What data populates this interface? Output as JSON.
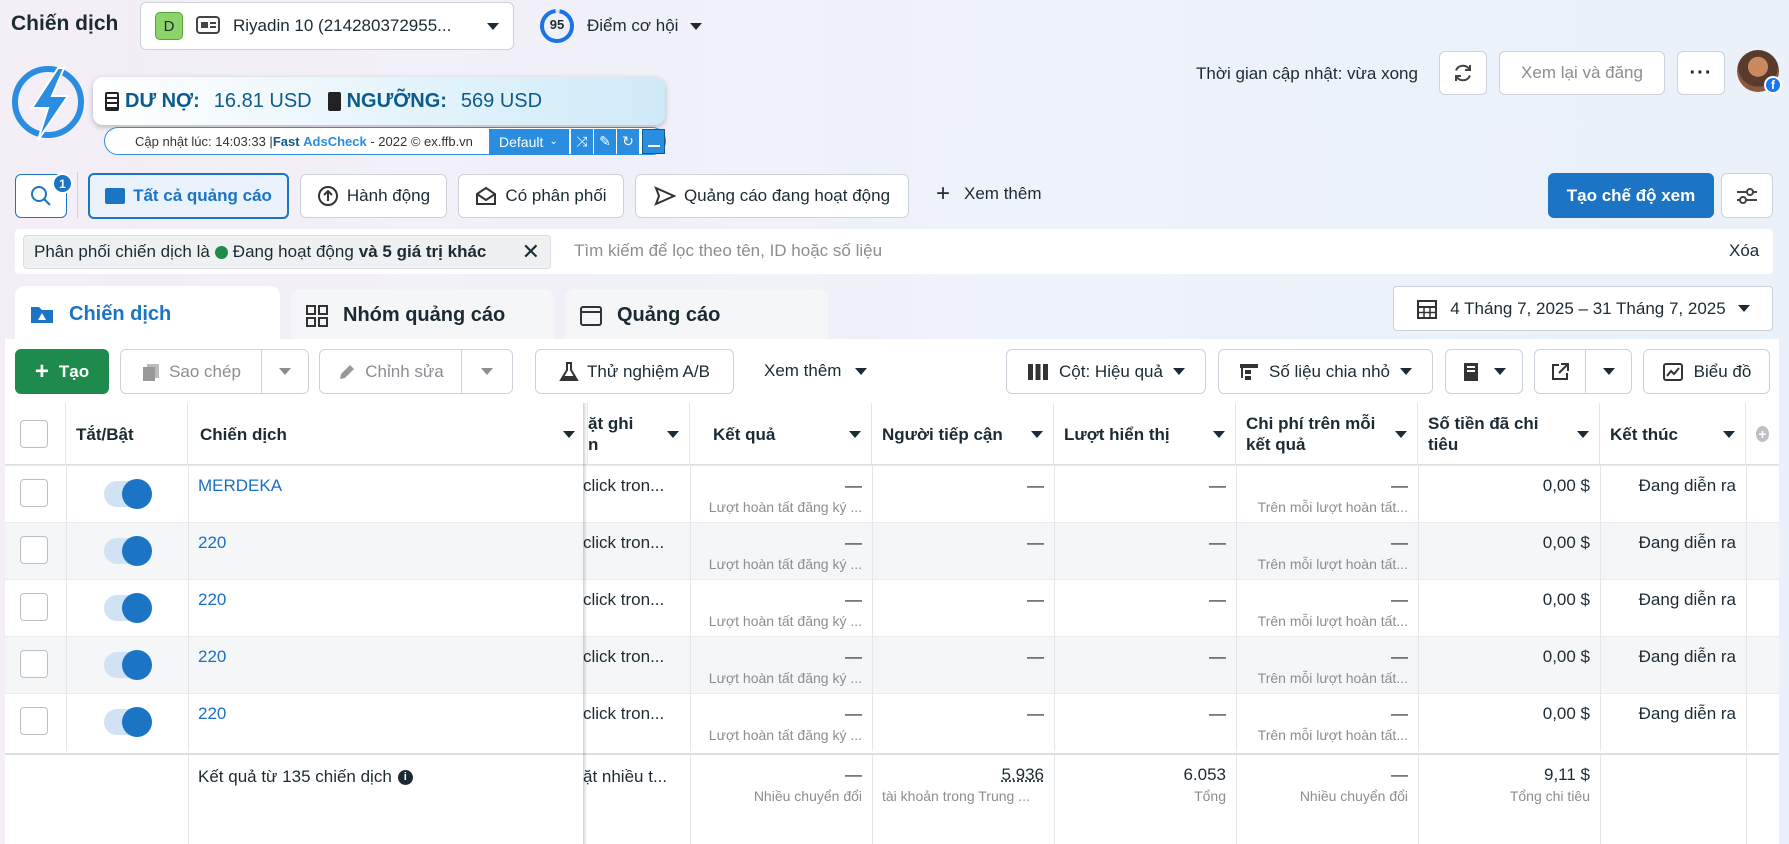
{
  "header": {
    "title": "Chiến dịch",
    "account_letter": "D",
    "account_name": "Riyadin 10 (214280372955...",
    "score": "95",
    "opportunity_label": "Điểm cơ hội",
    "update_time": "Thời gian cập nhật: vừa xong",
    "review_publish": "Xem lại và đăng"
  },
  "adscheck": {
    "debt_label": "DƯ NỢ:",
    "debt_value": "16.81 USD",
    "threshold_label": "NGƯỠNG:",
    "threshold_value": "569 USD",
    "updated_prefix": "Cập nhật lúc: 14:03:33 | ",
    "brand_fast": "Fast ",
    "brand_name": "AdsCheck",
    "suffix": " - 2022 © ex.ffb.vn",
    "mode": "Default"
  },
  "search_badge": "1",
  "filters": {
    "all_ads": "Tất cả quảng cáo",
    "actions": "Hành động",
    "delivered": "Có phân phối",
    "active_ads": "Quảng cáo đang hoạt động",
    "see_more": "Xem thêm",
    "create_view": "Tạo chế độ xem"
  },
  "filter_bar": {
    "chip_prefix": "Phân phối chiến dịch là",
    "chip_status": "Đang hoạt động",
    "chip_more": "và 5 giá trị khác",
    "search_placeholder": "Tìm kiếm để lọc theo tên, ID hoặc số liệu",
    "clear": "Xóa"
  },
  "tabs": {
    "campaigns": "Chiến dịch",
    "ad_sets": "Nhóm quảng cáo",
    "ads": "Quảng cáo"
  },
  "date_range": "4 Tháng 7, 2025 – 31 Tháng 7, 2025",
  "toolbar": {
    "create": "Tạo",
    "duplicate": "Sao chép",
    "edit": "Chỉnh sửa",
    "ab_test": "Thử nghiệm A/B",
    "more": "Xem thêm",
    "columns": "Cột: Hiệu quả",
    "breakdown": "Số liệu chia nhỏ",
    "chart": "Biểu đồ"
  },
  "columns": {
    "toggle": "Tắt/Bật",
    "campaign": "Chiến dịch",
    "bid": "ặt ghi",
    "bid2": "n",
    "results": "Kết quả",
    "reach": "Người tiếp cận",
    "impressions": "Lượt hiển thị",
    "cpr": "Chi phí trên mỗi",
    "cpr2": "kết quả",
    "spent": "Số tiền đã chi",
    "spent2": "tiêu",
    "ends": "Kết thúc"
  },
  "rows": [
    {
      "name": "MERDEKA",
      "bid": "click tron...",
      "result": "—",
      "result_sub": "Lượt hoàn tất đăng ký ...",
      "reach": "—",
      "impressions": "—",
      "cpr": "—",
      "cpr_sub": "Trên mỗi lượt hoàn tất...",
      "spent": "0,00 $",
      "ends": "Đang diễn ra"
    },
    {
      "name": "220",
      "bid": "click tron...",
      "result": "—",
      "result_sub": "Lượt hoàn tất đăng ký ...",
      "reach": "—",
      "impressions": "—",
      "cpr": "—",
      "cpr_sub": "Trên mỗi lượt hoàn tất...",
      "spent": "0,00 $",
      "ends": "Đang diễn ra"
    },
    {
      "name": "220",
      "bid": "click tron...",
      "result": "—",
      "result_sub": "Lượt hoàn tất đăng ký ...",
      "reach": "—",
      "impressions": "—",
      "cpr": "—",
      "cpr_sub": "Trên mỗi lượt hoàn tất...",
      "spent": "0,00 $",
      "ends": "Đang diễn ra"
    },
    {
      "name": "220",
      "bid": "click tron...",
      "result": "—",
      "result_sub": "Lượt hoàn tất đăng ký ...",
      "reach": "—",
      "impressions": "—",
      "cpr": "—",
      "cpr_sub": "Trên mỗi lượt hoàn tất...",
      "spent": "0,00 $",
      "ends": "Đang diễn ra"
    },
    {
      "name": "220",
      "bid": "click tron...",
      "result": "—",
      "result_sub": "Lượt hoàn tất đăng ký ...",
      "reach": "—",
      "impressions": "—",
      "cpr": "—",
      "cpr_sub": "Trên mỗi lượt hoàn tất...",
      "spent": "0,00 $",
      "ends": "Đang diễn ra"
    }
  ],
  "summary": {
    "label": "Kết quả từ 135 chiến dịch",
    "bid": "ặt nhiều t...",
    "result": "—",
    "result_sub": "Nhiều chuyển đổi",
    "reach": "5.936",
    "reach_sub": "tài khoản trong Trung ...",
    "impressions": "6.053",
    "impressions_sub": "Tổng",
    "cpr": "—",
    "cpr_sub": "Nhiều chuyển đổi",
    "spent": "9,11 $",
    "spent_sub": "Tổng chi tiêu"
  }
}
